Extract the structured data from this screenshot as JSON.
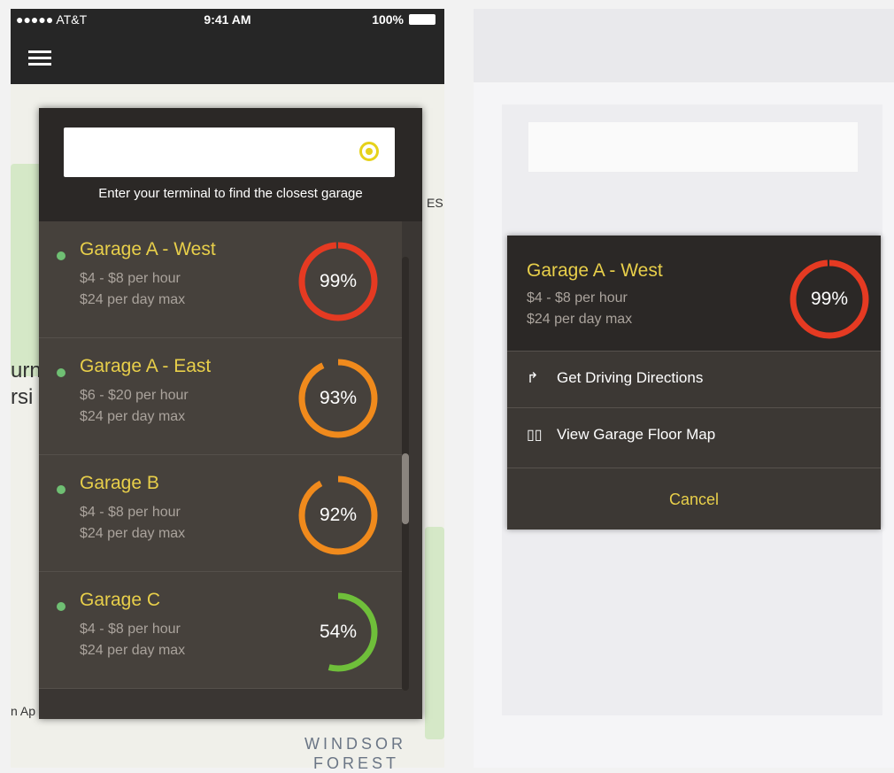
{
  "left": {
    "status": {
      "carrier": "●●●●● AT&T",
      "time": "9:41 AM",
      "battery": "100%"
    },
    "map_labels": {
      "windsor": "WINDSOR",
      "forest": "FOREST",
      "es": "ES",
      "urn": "urn",
      "rsi": "rsi",
      "ap": "n Ap"
    },
    "search": {
      "placeholder": "",
      "hint": "Enter your terminal to find the closest garage"
    },
    "garages": [
      {
        "name": "Garage A - West",
        "rate": "$4 - $8 per hour",
        "max": "$24 per day max",
        "percent": "99%",
        "pct": 0.99,
        "color": "#e53a22"
      },
      {
        "name": "Garage A - East",
        "rate": "$6 - $20 per hour",
        "max": "$24 per day max",
        "percent": "93%",
        "pct": 0.93,
        "color": "#f08a1c"
      },
      {
        "name": "Garage B",
        "rate": "$4 - $8 per hour",
        "max": "$24 per day max",
        "percent": "92%",
        "pct": 0.92,
        "color": "#f08a1c"
      },
      {
        "name": "Garage C",
        "rate": "$4 - $8 per hour",
        "max": "$24 per day max",
        "percent": "54%",
        "pct": 0.54,
        "color": "#6fbf3a"
      }
    ]
  },
  "right": {
    "selected": {
      "name": "Garage A - West",
      "rate": "$4 - $8 per hour",
      "max": "$24 per day max",
      "percent": "99%",
      "pct": 0.99,
      "color": "#e53a22"
    },
    "actions": {
      "directions": "Get Driving Directions",
      "floor_map": "View Garage Floor Map",
      "cancel": "Cancel"
    }
  }
}
